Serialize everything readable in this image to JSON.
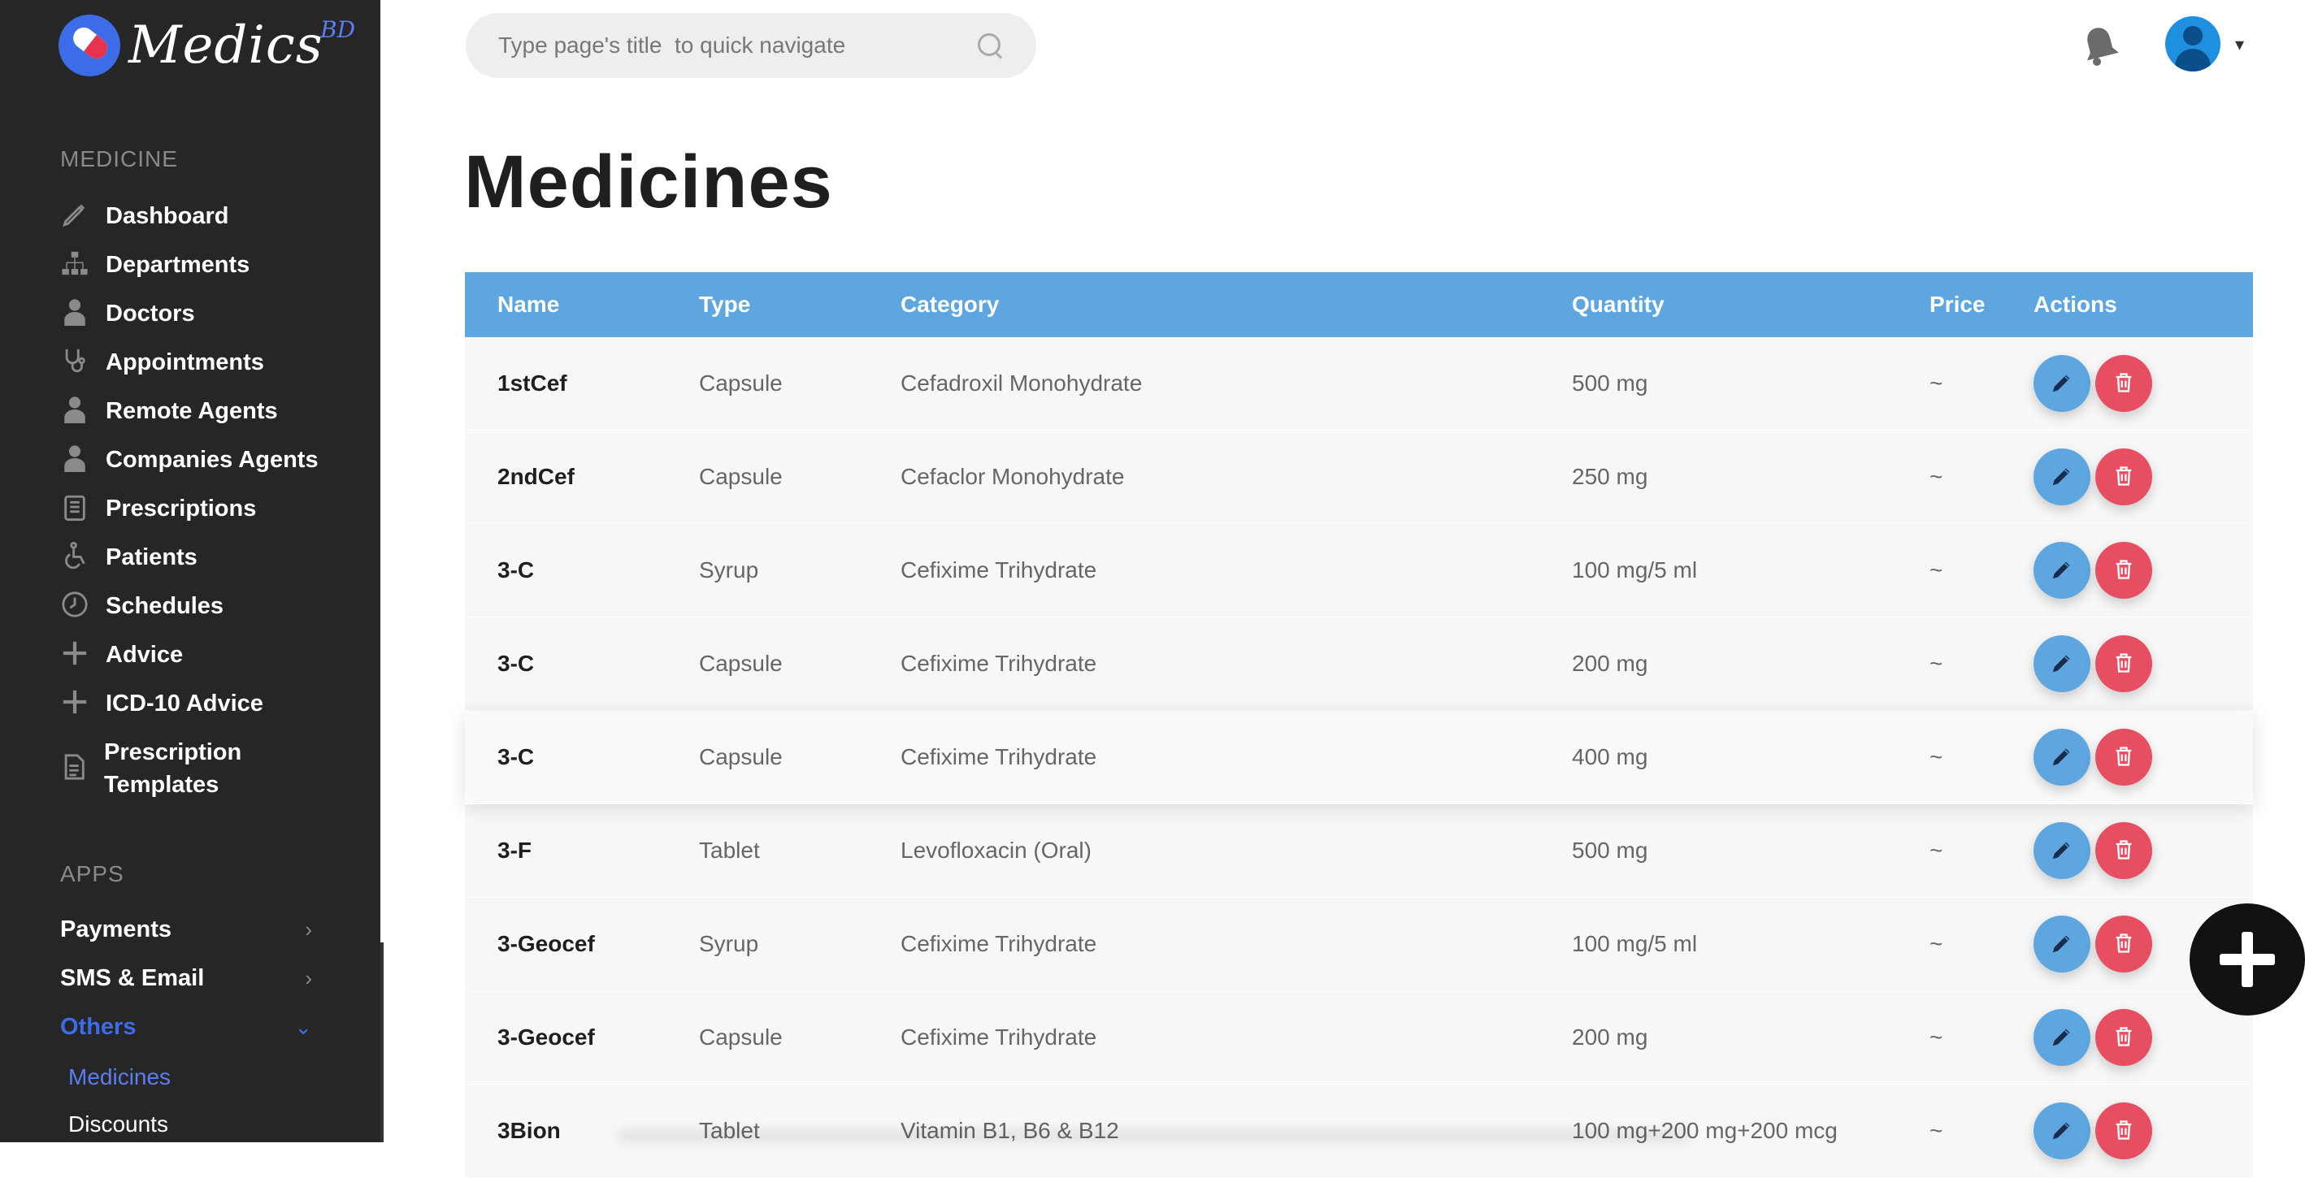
{
  "app": {
    "logo_text": "Medics",
    "logo_sup": "BD"
  },
  "search": {
    "placeholder": "Type page's title  to quick navigate"
  },
  "sidebar": {
    "medicine_title": "MEDICINE",
    "items": [
      {
        "label": "Dashboard",
        "icon": "pencil-icon"
      },
      {
        "label": "Departments",
        "icon": "sitemap-icon"
      },
      {
        "label": "Doctors",
        "icon": "doctor-icon"
      },
      {
        "label": "Appointments",
        "icon": "stethoscope-icon"
      },
      {
        "label": "Remote Agents",
        "icon": "agent-icon"
      },
      {
        "label": "Companies Agents",
        "icon": "agent-icon"
      },
      {
        "label": "Prescriptions",
        "icon": "clipboard-icon"
      },
      {
        "label": "Patients",
        "icon": "wheelchair-icon"
      },
      {
        "label": "Schedules",
        "icon": "clock-icon"
      },
      {
        "label": "Advice",
        "icon": "plus-icon"
      },
      {
        "label": "ICD-10 Advice",
        "icon": "plus-icon"
      },
      {
        "label": "Prescription Templates",
        "icon": "document-icon"
      }
    ],
    "apps_title": "APPS",
    "apps": [
      {
        "label": "Payments"
      },
      {
        "label": "SMS & Email"
      },
      {
        "label": "Others"
      }
    ],
    "sub_items": [
      {
        "label": "Medicines"
      },
      {
        "label": "Discounts"
      }
    ]
  },
  "main": {
    "title": "Medicines",
    "columns": [
      "Name",
      "Type",
      "Category",
      "Quantity",
      "Price",
      "Actions"
    ],
    "rows": [
      {
        "name": "1stCef",
        "type": "Capsule",
        "category": "Cefadroxil Monohydrate",
        "quantity": "500 mg",
        "price": "~"
      },
      {
        "name": "2ndCef",
        "type": "Capsule",
        "category": "Cefaclor Monohydrate",
        "quantity": "250 mg",
        "price": "~"
      },
      {
        "name": "3-C",
        "type": "Syrup",
        "category": "Cefixime Trihydrate",
        "quantity": "100 mg/5 ml",
        "price": "~"
      },
      {
        "name": "3-C",
        "type": "Capsule",
        "category": "Cefixime Trihydrate",
        "quantity": "200 mg",
        "price": "~"
      },
      {
        "name": "3-C",
        "type": "Capsule",
        "category": "Cefixime Trihydrate",
        "quantity": "400 mg",
        "price": "~"
      },
      {
        "name": "3-F",
        "type": "Tablet",
        "category": "Levofloxacin (Oral)",
        "quantity": "500 mg",
        "price": "~"
      },
      {
        "name": "3-Geocef",
        "type": "Syrup",
        "category": "Cefixime Trihydrate",
        "quantity": "100 mg/5 ml",
        "price": "~"
      },
      {
        "name": "3-Geocef",
        "type": "Capsule",
        "category": "Cefixime Trihydrate",
        "quantity": "200 mg",
        "price": "~"
      },
      {
        "name": "3Bion",
        "type": "Tablet",
        "category": "Vitamin B1, B6 & B12",
        "quantity": "100 mg+200 mg+200 mcg",
        "price": "~"
      }
    ]
  },
  "colors": {
    "sidebar_bg": "#262626",
    "accent_blue": "#5ea6e0",
    "delete_red": "#e84e62",
    "active_link": "#3d6ce8"
  }
}
